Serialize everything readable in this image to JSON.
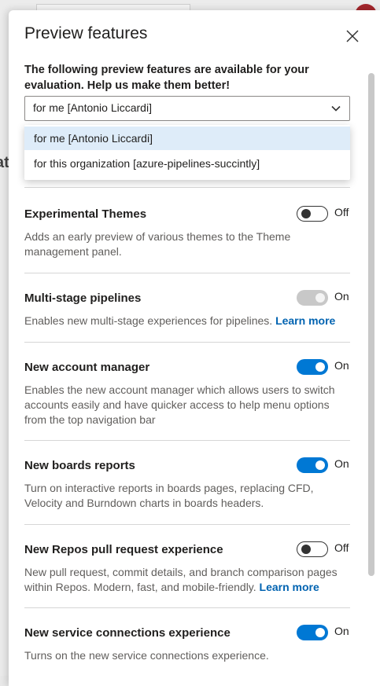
{
  "panel": {
    "title": "Preview features",
    "intro": "The following preview features are available for your evaluation. Help us make them better!"
  },
  "scope_dropdown": {
    "selected": "for me [Antonio Liccardi]",
    "options": [
      "for me [Antonio Liccardi]",
      "for this organization [azure-pipelines-succintly]"
    ]
  },
  "background": {
    "fragment_1": "at"
  },
  "features": [
    {
      "name": "Experimental Themes",
      "description": "Adds an early preview of various themes to the Theme management panel.",
      "state": "Off",
      "learn_more": ""
    },
    {
      "name": "Multi-stage pipelines",
      "description": "Enables new multi-stage experiences for pipelines.",
      "state": "On",
      "learn_more": "Learn more"
    },
    {
      "name": "New account manager",
      "description": "Enables the new account manager which allows users to switch accounts easily and have quicker access to help menu options from the top navigation bar",
      "state": "On",
      "learn_more": ""
    },
    {
      "name": "New boards reports",
      "description": "Turn on interactive reports in boards pages, replacing CFD, Velocity and Burndown charts in boards headers.",
      "state": "On",
      "learn_more": ""
    },
    {
      "name": "New Repos pull request experience",
      "description": "New pull request, commit details, and branch comparison pages within Repos. Modern, fast, and mobile-friendly.",
      "state": "Off",
      "learn_more": "Learn more"
    },
    {
      "name": "New service connections experience",
      "description": "Turns on the new service connections experience.",
      "state": "On",
      "learn_more": ""
    }
  ],
  "colors": {
    "accent": "#0078d4",
    "link": "#0063b1",
    "selected_option": "#deecf9"
  }
}
